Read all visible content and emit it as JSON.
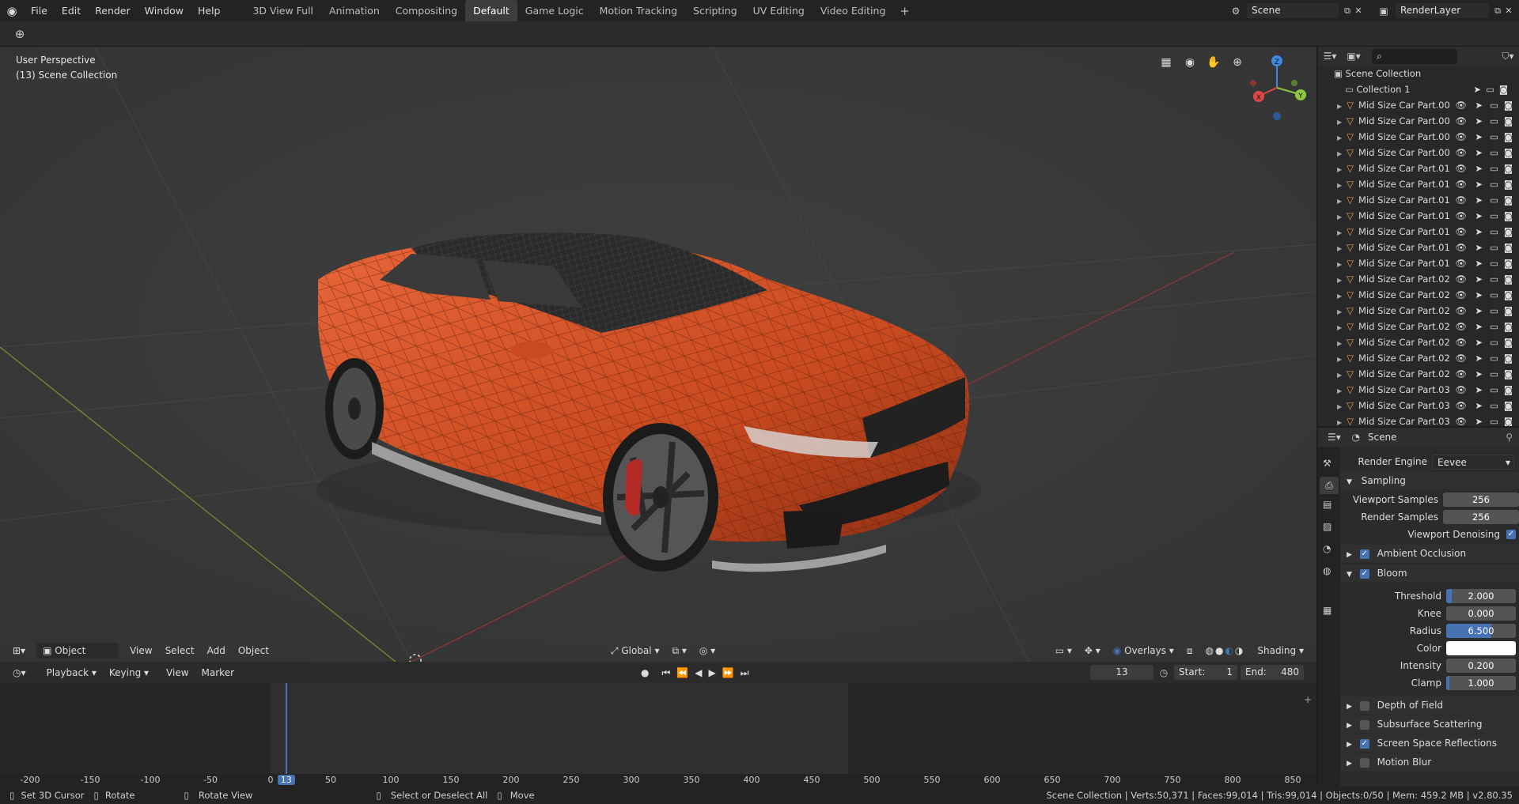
{
  "menu": [
    "File",
    "Edit",
    "Render",
    "Window",
    "Help"
  ],
  "workspaces": [
    "3D View Full",
    "Animation",
    "Compositing",
    "Default",
    "Game Logic",
    "Motion Tracking",
    "Scripting",
    "UV Editing",
    "Video Editing"
  ],
  "active_workspace": "Default",
  "scene_name": "Scene",
  "render_layer": "RenderLayer",
  "viewport": {
    "perspective": "User Perspective",
    "collection": "(13) Scene Collection",
    "mode": "Object Mode",
    "menus": [
      "View",
      "Select",
      "Add",
      "Object"
    ],
    "transform_orientation": "Global",
    "overlays": "Overlays",
    "shading": "Shading",
    "axes": {
      "x": "X",
      "y": "Y",
      "z": "Z"
    }
  },
  "timeline": {
    "menus": [
      "Playback",
      "Keying",
      "View",
      "Marker"
    ],
    "current_frame": "13",
    "start_label": "Start:",
    "start": "1",
    "end_label": "End:",
    "end": "480",
    "ticks": [
      "-200",
      "-150",
      "-100",
      "-50",
      "0",
      "13",
      "50",
      "100",
      "150",
      "200",
      "250",
      "300",
      "350",
      "400",
      "450",
      "500",
      "550",
      "600",
      "650",
      "700",
      "750",
      "800",
      "850"
    ]
  },
  "outliner": {
    "root": "Scene Collection",
    "collection": "Collection 1",
    "items": [
      "Mid Size Car Part.00",
      "Mid Size Car Part.00",
      "Mid Size Car Part.00",
      "Mid Size Car Part.00",
      "Mid Size Car Part.01",
      "Mid Size Car Part.01",
      "Mid Size Car Part.01",
      "Mid Size Car Part.01",
      "Mid Size Car Part.01",
      "Mid Size Car Part.01",
      "Mid Size Car Part.01",
      "Mid Size Car Part.02",
      "Mid Size Car Part.02",
      "Mid Size Car Part.02",
      "Mid Size Car Part.02",
      "Mid Size Car Part.02",
      "Mid Size Car Part.02",
      "Mid Size Car Part.02",
      "Mid Size Car Part.03",
      "Mid Size Car Part.03",
      "Mid Size Car Part.03"
    ]
  },
  "properties": {
    "context": "Scene",
    "render_engine_label": "Render Engine",
    "render_engine": "Eevee",
    "sampling": "Sampling",
    "viewport_samples_label": "Viewport Samples",
    "viewport_samples": "256",
    "render_samples_label": "Render Samples",
    "render_samples": "256",
    "viewport_denoising": "Viewport Denoising",
    "ambient_occlusion": "Ambient Occlusion",
    "bloom": "Bloom",
    "threshold_label": "Threshold",
    "threshold": "2.000",
    "threshold_fill": 0.08,
    "knee_label": "Knee",
    "knee": "0.000",
    "knee_fill": 0.0,
    "radius_label": "Radius",
    "radius": "6.500",
    "radius_fill": 0.65,
    "color_label": "Color",
    "intensity_label": "Intensity",
    "intensity": "0.200",
    "intensity_fill": 0.0,
    "clamp_label": "Clamp",
    "clamp": "1.000",
    "clamp_fill": 0.05,
    "depth_of_field": "Depth of Field",
    "subsurface_scattering": "Subsurface Scattering",
    "screen_space_reflections": "Screen Space Reflections",
    "motion_blur": "Motion Blur"
  },
  "status": {
    "set_cursor": "Set 3D Cursor",
    "rotate": "Rotate",
    "rotate_view": "Rotate View",
    "select": "Select or Deselect All",
    "move": "Move",
    "stats": "Scene Collection | Verts:50,371 | Faces:99,014 | Tris:99,014 | Objects:0/50 | Mem: 459.2 MB | v2.80.35"
  },
  "colors": {
    "accent": "#4772b3",
    "car_body": "#d9572a",
    "axis_x": "#e0484a",
    "axis_y": "#8ec63f",
    "axis_z": "#3f88e0"
  }
}
